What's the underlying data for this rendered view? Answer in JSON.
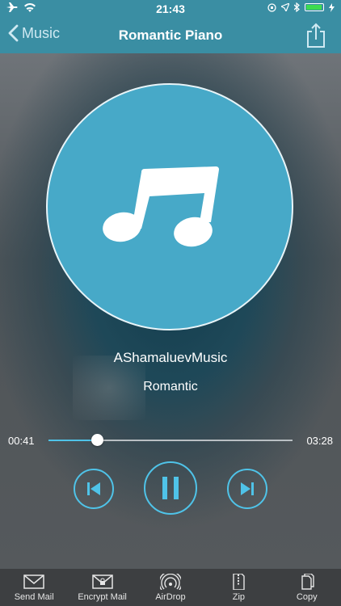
{
  "status_bar": {
    "time": "21:43",
    "battery_fill": 0.95
  },
  "nav": {
    "back_label": "Music",
    "title": "Romantic Piano"
  },
  "track": {
    "artist": "AShamaluevMusic",
    "album": "Romantic"
  },
  "playback": {
    "current_time": "00:41",
    "duration": "03:28",
    "progress": 0.2
  },
  "colors": {
    "accent": "#4fc3e8",
    "nav_bg": "#3a8ea3",
    "artwork_bg": "#47a9c8",
    "toolbar_bg": "#3d3f41"
  },
  "toolbar": {
    "items": [
      {
        "label": "Send Mail",
        "icon": "envelope-icon"
      },
      {
        "label": "Encrypt Mail",
        "icon": "encrypted-envelope-icon"
      },
      {
        "label": "AirDrop",
        "icon": "airdrop-icon"
      },
      {
        "label": "Zip",
        "icon": "zip-file-icon"
      },
      {
        "label": "Copy",
        "icon": "copy-icon"
      }
    ]
  }
}
